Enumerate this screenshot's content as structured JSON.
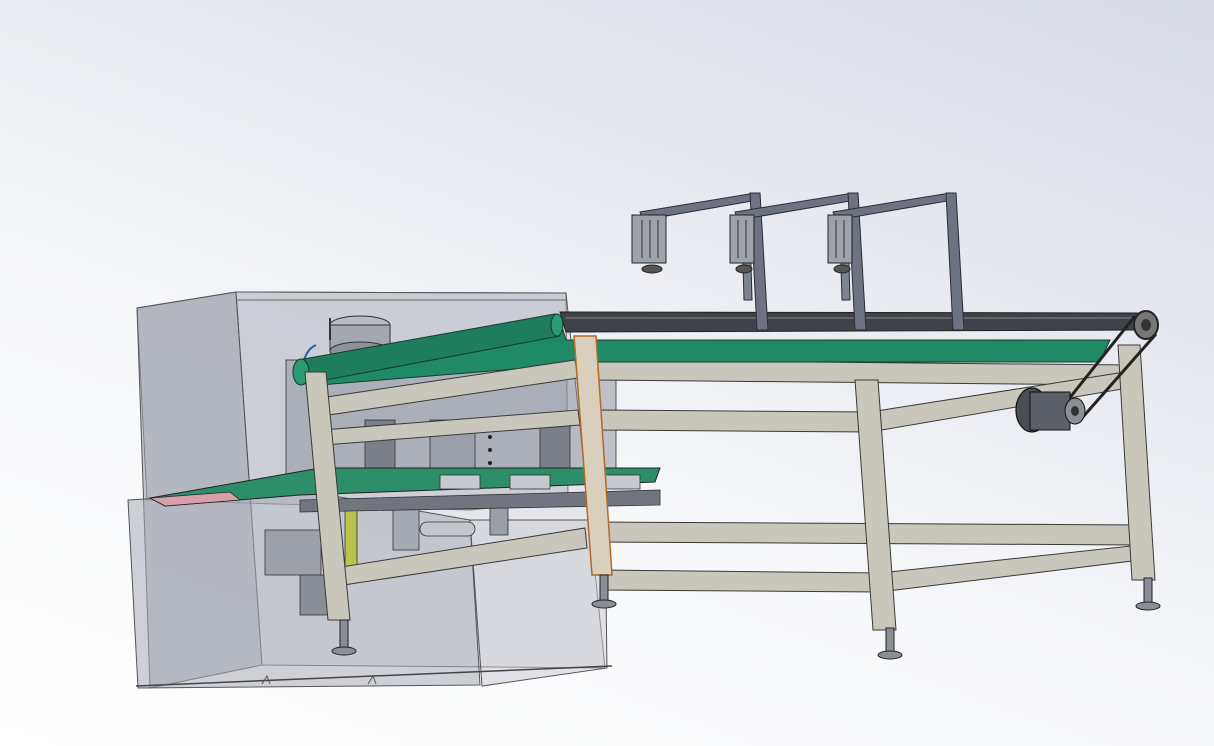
{
  "view": {
    "background_top": "#d7dbe6",
    "background_bottom": "#ffffff"
  },
  "model": {
    "frame_color": "#c9c6bc",
    "frame_edge_color": "#3a3a3a",
    "conveyor_belt_color": "#1f8a66",
    "enclosure_color": "#a9adb8",
    "bracket_color": "#6d7380"
  }
}
